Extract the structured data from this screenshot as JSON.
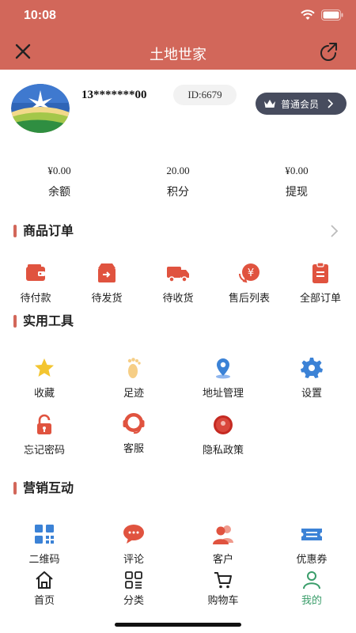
{
  "status_bar": {
    "time": "10:08"
  },
  "nav": {
    "title": "土地世家",
    "close_icon": "close-icon",
    "share_icon": "share-icon"
  },
  "profile": {
    "phone": "13*******00",
    "id_label": "ID:6679",
    "member_label": "普通会员",
    "member_icon": "crown-icon"
  },
  "stats": [
    {
      "value": "¥0.00",
      "label": "余额"
    },
    {
      "value": "20.00",
      "label": "积分"
    },
    {
      "value": "¥0.00",
      "label": "提现"
    }
  ],
  "orders": {
    "title": "商品订单",
    "items": [
      {
        "label": "待付款",
        "icon": "wallet-icon"
      },
      {
        "label": "待发货",
        "icon": "box-icon"
      },
      {
        "label": "待收货",
        "icon": "truck-icon"
      },
      {
        "label": "售后列表",
        "icon": "refund-icon"
      },
      {
        "label": "全部订单",
        "icon": "clipboard-icon"
      }
    ]
  },
  "tools": {
    "title": "实用工具",
    "items": [
      {
        "label": "收藏",
        "icon": "star-icon"
      },
      {
        "label": "足迹",
        "icon": "footprint-icon"
      },
      {
        "label": "地址管理",
        "icon": "location-icon"
      },
      {
        "label": "设置",
        "icon": "gear-icon"
      },
      {
        "label": "忘记密码",
        "icon": "lock-icon"
      },
      {
        "label": "客服",
        "icon": "headset-icon"
      },
      {
        "label": "隐私政策",
        "icon": "privacy-icon"
      }
    ]
  },
  "marketing": {
    "title": "营销互动",
    "items": [
      {
        "label": "二维码",
        "icon": "qrcode-icon"
      },
      {
        "label": "评论",
        "icon": "comment-icon"
      },
      {
        "label": "客户",
        "icon": "users-icon"
      },
      {
        "label": "优惠券",
        "icon": "coupon-icon"
      }
    ]
  },
  "tabbar": [
    {
      "label": "首页",
      "icon": "home-icon"
    },
    {
      "label": "分类",
      "icon": "category-icon"
    },
    {
      "label": "购物车",
      "icon": "cart-icon"
    },
    {
      "label": "我的",
      "icon": "profile-icon",
      "active": true
    }
  ],
  "colors": {
    "brand": "#d2675a",
    "member_badge": "#474c5e",
    "active_tab": "#3a9d6a",
    "tool_icon_yellow": "#f3c530",
    "tool_icon_blue": "#3b82d6"
  }
}
